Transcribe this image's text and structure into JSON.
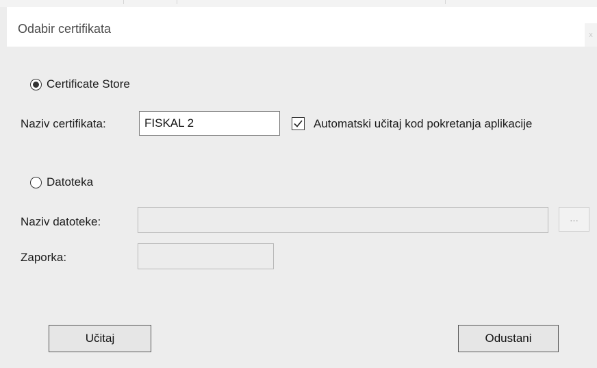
{
  "dialog": {
    "title": "Odabir certifikata",
    "close_glyph": "x"
  },
  "certificate_store": {
    "radio_label": "Certificate Store",
    "selected": true,
    "name_label": "Naziv certifikata:",
    "name_value": "FISKAL 2",
    "autoload_label": "Automatski učitaj kod pokretanja aplikacije",
    "autoload_checked": true
  },
  "file": {
    "radio_label": "Datoteka",
    "selected": false,
    "file_label": "Naziv datoteke:",
    "file_value": "",
    "browse_label": "...",
    "password_label": "Zaporka:",
    "password_value": ""
  },
  "buttons": {
    "load_label": "Učitaj",
    "cancel_label": "Odustani"
  },
  "icons": {
    "checkbox_mark": "checkmark-icon"
  }
}
